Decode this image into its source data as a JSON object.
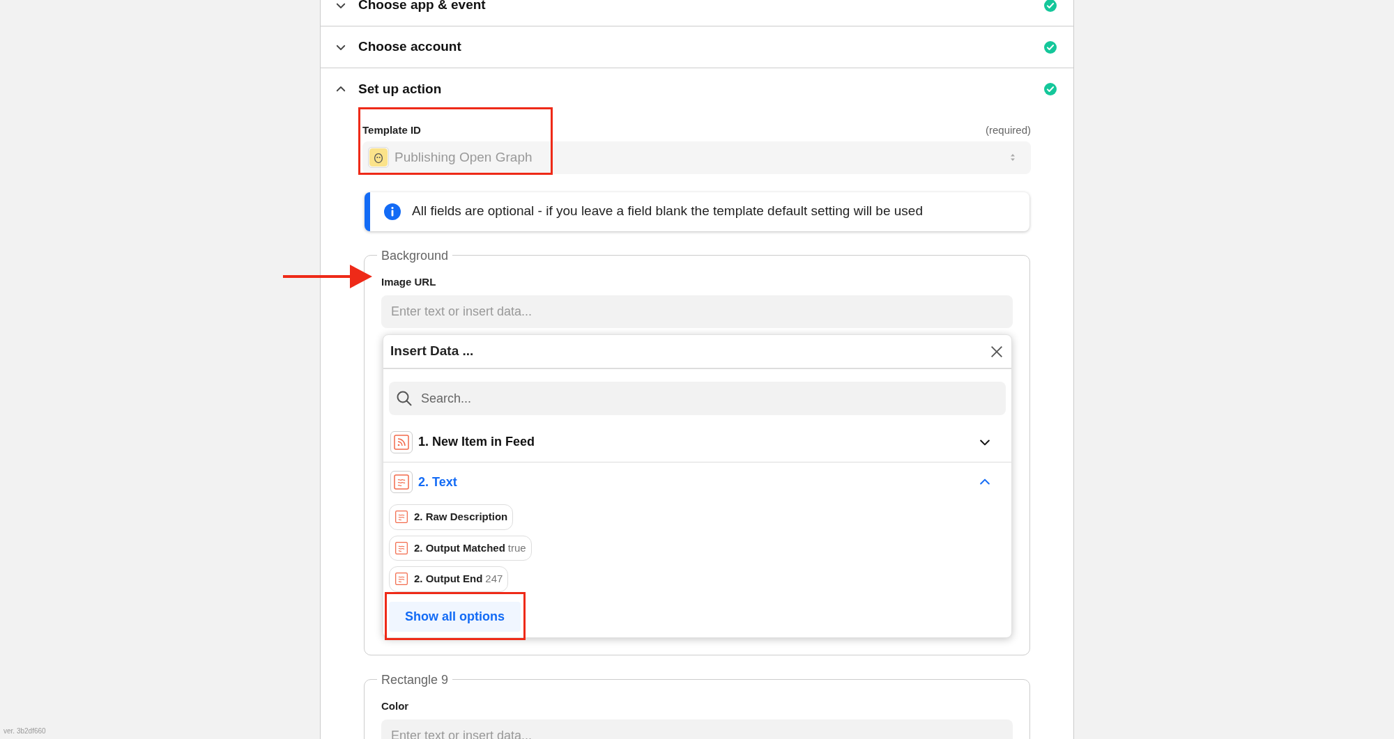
{
  "steps": [
    {
      "title": "Choose app & event",
      "expanded": false,
      "complete": true
    },
    {
      "title": "Choose account",
      "expanded": false,
      "complete": true
    },
    {
      "title": "Set up action",
      "expanded": true,
      "complete": true
    }
  ],
  "template_field": {
    "label": "Template ID",
    "required_note": "(required)",
    "value": "Publishing Open Graph"
  },
  "info": "All fields are optional - if you leave a field blank the template default setting will be used",
  "groups": [
    {
      "legend": "Background",
      "fields": [
        {
          "label": "Image URL",
          "placeholder": "Enter text or insert data...",
          "insert_data": {
            "title": "Insert Data ...",
            "search_placeholder": "Search...",
            "sources": [
              {
                "title": "1. New Item in Feed",
                "kind": "feed",
                "expanded": false
              },
              {
                "title": "2. Text",
                "kind": "text",
                "expanded": true,
                "items": [
                  {
                    "label": "2. Raw Description"
                  },
                  {
                    "label": "2. Output Matched",
                    "value": "true"
                  },
                  {
                    "label": "2. Output End",
                    "value": "247"
                  }
                ]
              }
            ],
            "show_all": "Show all options"
          }
        }
      ]
    },
    {
      "legend": "Rectangle 9",
      "fields": [
        {
          "label": "Color",
          "placeholder": "Enter text or insert data..."
        }
      ]
    }
  ],
  "version": "ver. 3b2df660"
}
